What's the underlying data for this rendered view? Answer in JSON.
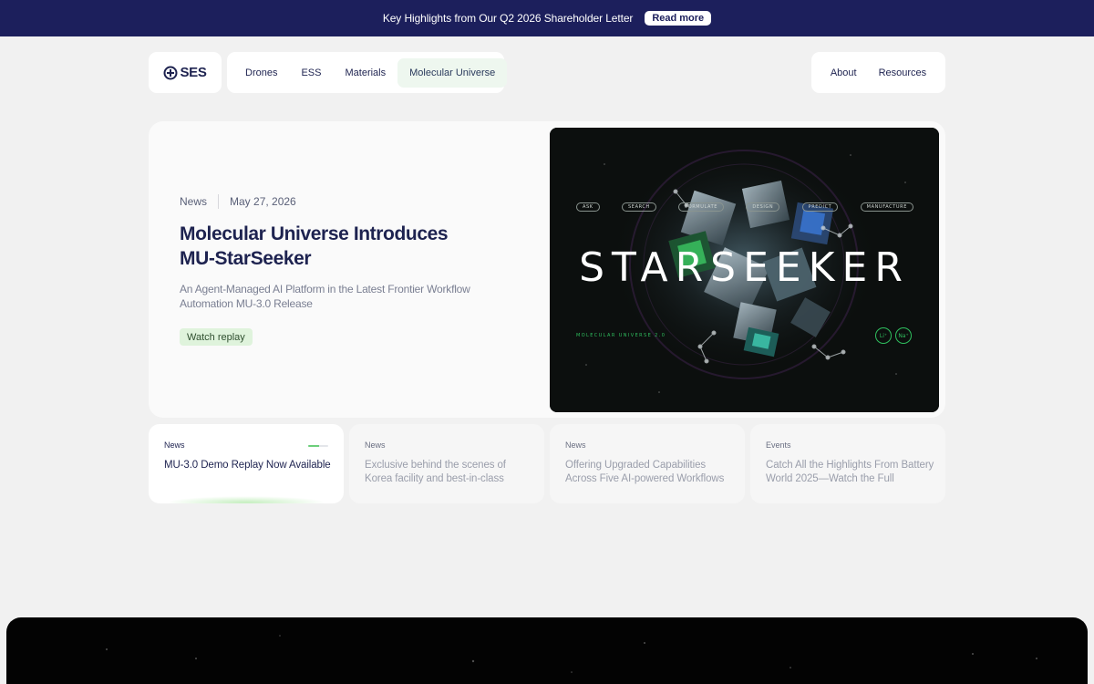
{
  "announcement": {
    "text": "Key Highlights from Our Q2 2026 Shareholder Letter",
    "button_label": "Read more"
  },
  "logo": {
    "text": "SES"
  },
  "nav": {
    "items": [
      {
        "label": "Drones",
        "active": false
      },
      {
        "label": "ESS",
        "active": false
      },
      {
        "label": "Materials",
        "active": false
      },
      {
        "label": "Molecular Universe",
        "active": true
      }
    ],
    "right_items": [
      {
        "label": "About"
      },
      {
        "label": "Resources"
      }
    ]
  },
  "hero": {
    "category": "News",
    "date": "May 27, 2026",
    "title": "Molecular Universe Introduces MU-StarSeeker",
    "subtitle": "An Agent-Managed AI Platform in the Latest Frontier Workflow Automation MU-3.0 Release",
    "cta_label": "Watch replay",
    "media": {
      "title": "STARSEEKER",
      "tags": [
        "ASK",
        "SEARCH",
        "FORMULATE",
        "DESIGN",
        "PREDICT",
        "MANUFACTURE"
      ],
      "caption": "MOLECULAR UNIVERSE 2.0",
      "badges": [
        "Li⁺",
        "Na⁺"
      ],
      "accent_color": "#2fbf5e"
    }
  },
  "news": [
    {
      "category": "News",
      "title": "MU-3.0 Demo Replay Now Available",
      "active": true,
      "progress": 0.55
    },
    {
      "category": "News",
      "title": "Exclusive behind the scenes of Korea facility and best-in-class",
      "active": false
    },
    {
      "category": "News",
      "title": "Offering Upgraded Capabilities Across Five AI-powered Workflows",
      "active": false
    },
    {
      "category": "Events",
      "title": "Catch All the Highlights From Battery World 2025—Watch the Full",
      "active": false
    }
  ],
  "colors": {
    "brand_navy": "#1c1f5c",
    "page_bg": "#f1f1f1",
    "active_nav_bg": "#eef7ef",
    "cta_bg": "#dff3dc",
    "accent_green": "#6ccf7a"
  }
}
